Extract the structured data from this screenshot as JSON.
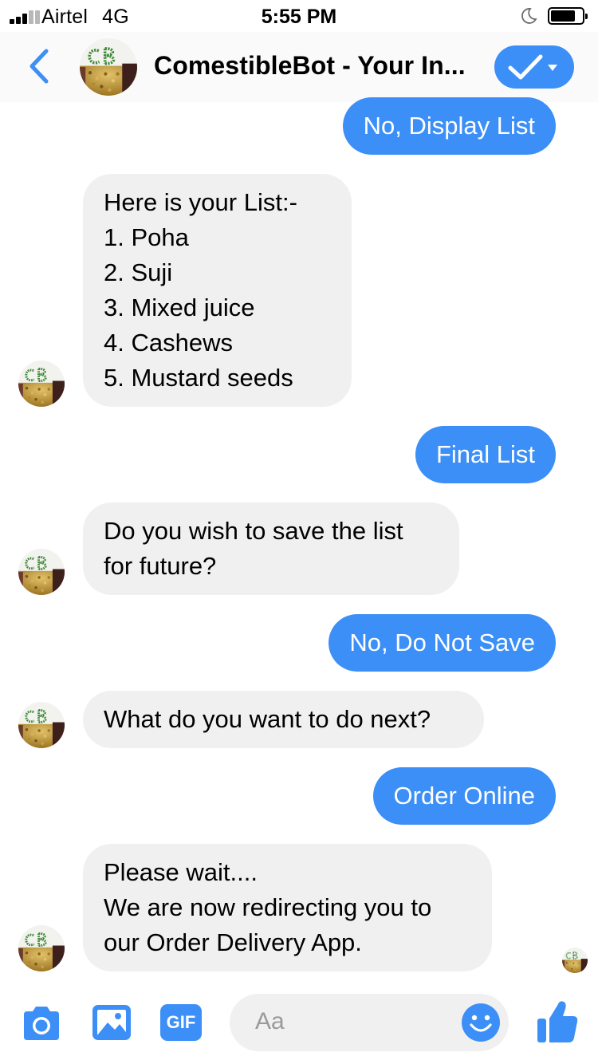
{
  "status": {
    "carrier": "Airtel",
    "network": "4G",
    "time": "5:55 PM"
  },
  "header": {
    "title": "ComestibleBot - Your In...",
    "avatar_text": "CB",
    "back_icon": "chevron-left-icon",
    "menu_icon": "checkmark-dropdown-icon"
  },
  "messages": [
    {
      "from": "user",
      "text": "No, Display List"
    },
    {
      "from": "bot",
      "lines": [
        "Here is your List:-",
        "1. Poha",
        "2. Suji",
        "3. Mixed juice",
        "4. Cashews",
        "5. Mustard seeds"
      ]
    },
    {
      "from": "user",
      "text": "Final List"
    },
    {
      "from": "bot",
      "lines": [
        "Do you wish to save the list",
        "for future?"
      ]
    },
    {
      "from": "user",
      "text": "No, Do Not Save"
    },
    {
      "from": "bot",
      "lines": [
        "What do you want to do next?"
      ]
    },
    {
      "from": "user",
      "text": "Order Online"
    },
    {
      "from": "bot",
      "lines": [
        "Please wait....",
        "We are now redirecting you to",
        "our Order Delivery App."
      ]
    }
  ],
  "composer": {
    "placeholder": "Aa",
    "gif_label": "GIF",
    "icons": [
      "camera-icon",
      "photo-icon",
      "gif-icon",
      "emoji-icon",
      "thumbs-up-icon"
    ]
  },
  "colors": {
    "accent": "#3c8ff6",
    "incoming_bubble": "#f0f0f0",
    "header_bg": "#fafafa"
  }
}
